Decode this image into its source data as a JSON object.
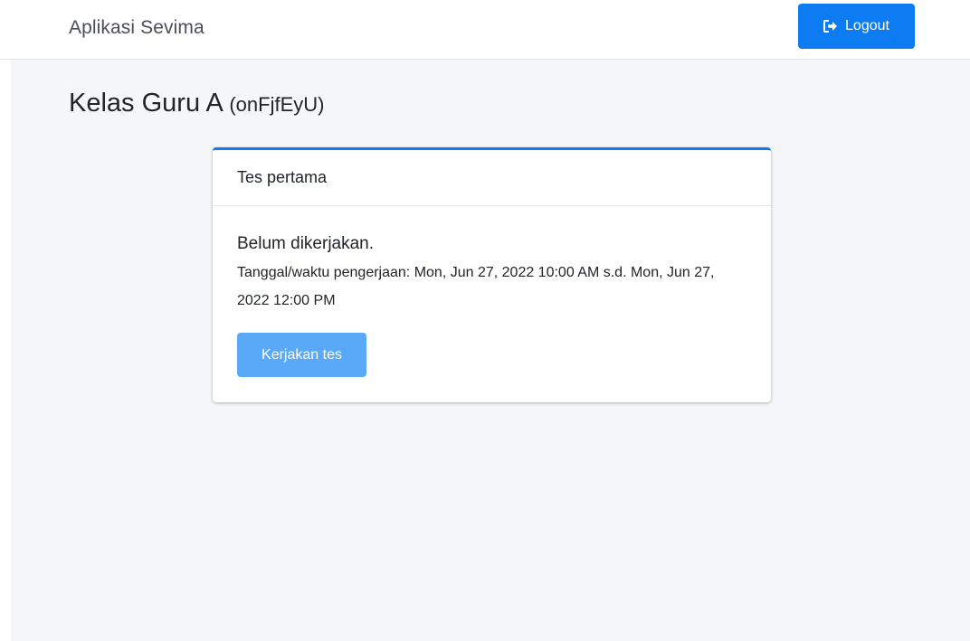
{
  "navbar": {
    "brand": "Aplikasi Sevima",
    "logout_label": "Logout",
    "logout_icon": "sign-out-icon"
  },
  "page": {
    "title": "Kelas Guru A",
    "class_code": "(onFjfEyU)"
  },
  "test_card": {
    "header": "Tes pertama",
    "status": "Belum dikerjakan.",
    "schedule": "Tanggal/waktu pengerjaan: Mon, Jun 27, 2022 10:00 AM s.d. Mon, Jun 27, 2022 12:00 PM",
    "action_label": "Kerjakan tes"
  },
  "colors": {
    "primary": "#0d7cf2",
    "primary_disabled": "#5aa9f8",
    "content_background": "#f4f6f9"
  }
}
